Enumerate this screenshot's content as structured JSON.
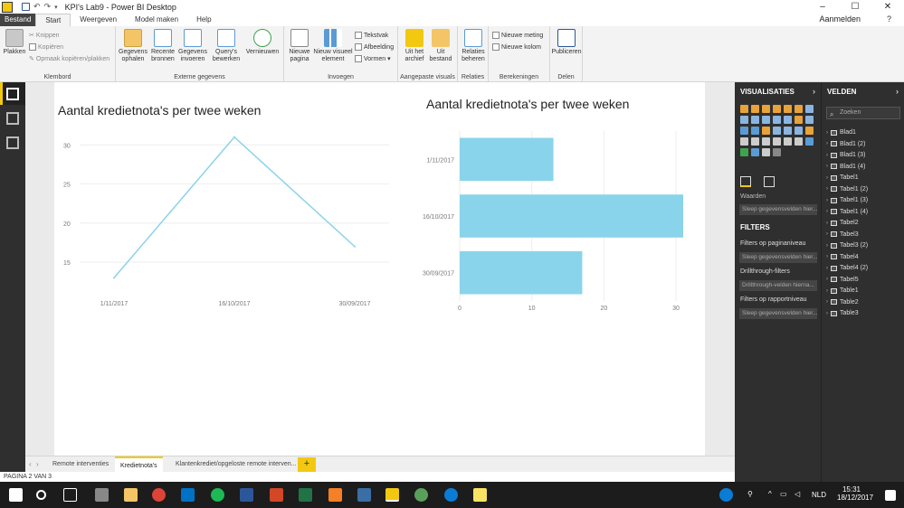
{
  "window": {
    "title": "KPI's Lab9 - Power BI Desktop",
    "controls": [
      "–",
      "☐",
      "✕"
    ]
  },
  "menu": {
    "items": [
      "Bestand",
      "Start",
      "Weergeven",
      "Model maken",
      "Help"
    ],
    "active": "Start",
    "sign_in": "Aanmelden"
  },
  "ribbon": {
    "klembord": {
      "label": "Klembord",
      "plakken": "Plakken",
      "knippen": "Knippen",
      "kopieren": "Kopiëren",
      "opmaak": "Opmaak kopiëren/plakken"
    },
    "externe": {
      "label": "Externe gegevens",
      "gegevens_ophalen": "Gegevens ophalen",
      "recente_bronnen": "Recente bronnen",
      "gegevens_invoeren": "Gegevens invoeren",
      "querys": "Query's bewerken",
      "vernieuwen": "Vernieuwen"
    },
    "invoegen": {
      "label": "Invoegen",
      "nieuwe_pagina": "Nieuwe pagina",
      "nieuw_visueel": "Nieuw visueel element",
      "tekstvak": "Tekstvak",
      "afbeelding": "Afbeelding",
      "vormen": "Vormen"
    },
    "aangepaste": {
      "label": "Aangepaste visuals",
      "uit_archief": "Uit het archief",
      "uit_bestand": "Uit bestand"
    },
    "relaties": {
      "label": "Relaties",
      "beheren": "Relaties beheren"
    },
    "berekeningen": {
      "label": "Berekeningen",
      "nieuwe_meting": "Nieuwe meting",
      "nieuwe_kolom": "Nieuwe kolom"
    },
    "delen": {
      "label": "Delen",
      "publiceren": "Publiceren"
    }
  },
  "chart_data": [
    {
      "type": "line",
      "title": "Aantal kredietnota's per twee weken",
      "categories": [
        "1/11/2017",
        "16/10/2017",
        "30/09/2017"
      ],
      "values": [
        13,
        31,
        17
      ],
      "yticks": [
        15,
        20,
        25,
        30
      ],
      "ylim": [
        12,
        32
      ],
      "color": "#8ad4eb"
    },
    {
      "type": "bar",
      "orientation": "horizontal",
      "title": "Aantal kredietnota's per twee weken",
      "categories": [
        "1/11/2017",
        "16/10/2017",
        "30/09/2017"
      ],
      "values": [
        13,
        31,
        17
      ],
      "xticks": [
        0,
        10,
        20,
        30
      ],
      "xlim": [
        0,
        31
      ],
      "color": "#8ad4eb"
    }
  ],
  "page_tabs": {
    "tabs": [
      "Remote interventies",
      "Kredietnota's",
      "Klantenkrediet/opgeloste remote interven..."
    ],
    "active": "Kredietnota's",
    "add": "+"
  },
  "status": "PAGINA 2 VAN 3",
  "visualizations": {
    "title": "VISUALISATIES",
    "values_label": "Waarden",
    "values_drop": "Sleep gegevensvelden hier...",
    "filters_title": "FILTERS",
    "filters": [
      "Filters op paginaniveau",
      "Sleep gegevensvelden hier...",
      "Drillthrough-filters",
      "Drillthrough-velden hierna...",
      "Filters op rapportniveau",
      "Sleep gegevensvelden hier..."
    ]
  },
  "fields": {
    "title": "VELDEN",
    "search_placeholder": "Zoeken",
    "tables": [
      "Blad1",
      "Blad1 (2)",
      "Blad1 (3)",
      "Blad1 (4)",
      "Tabel1",
      "Tabel1 (2)",
      "Tabel1 (3)",
      "Tabel1 (4)",
      "Tabel2",
      "Tabel3",
      "Tabel3 (2)",
      "Tabel4",
      "Tabel4 (2)",
      "Tabel5",
      "Table1",
      "Table2",
      "Table3"
    ]
  },
  "taskbar": {
    "language": "NLD",
    "time": "15:31",
    "date": "18/12/2017"
  }
}
